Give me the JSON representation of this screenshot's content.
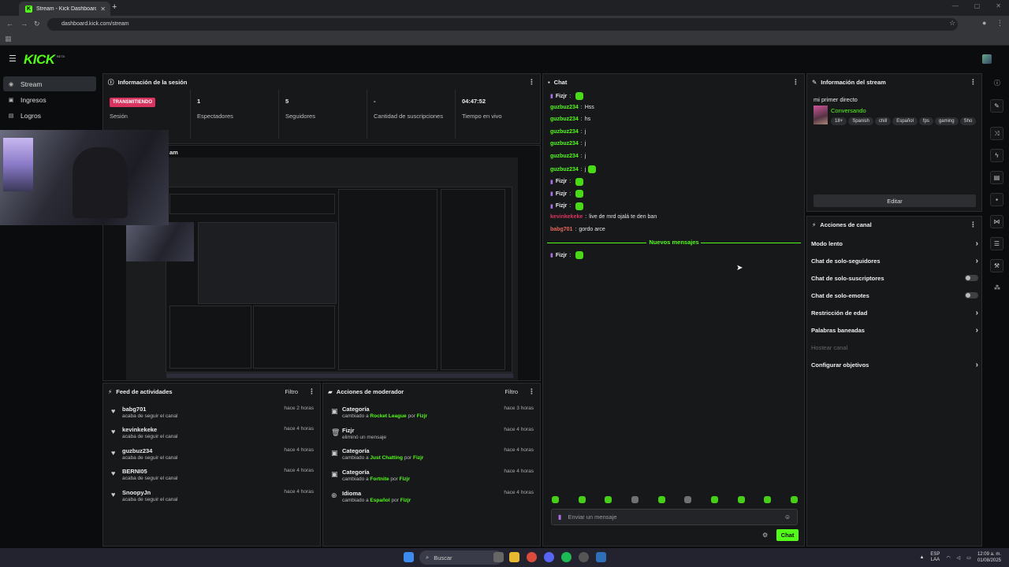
{
  "browser": {
    "tab_title": "Stream - Kick Dashboard",
    "url": "dashboard.kick.com/stream"
  },
  "header": {
    "logo": "KICK",
    "logo_badge": "BETA"
  },
  "sidebar": {
    "items": [
      {
        "label": "Stream",
        "icon": "video-icon"
      },
      {
        "label": "Ingresos",
        "icon": "money-icon"
      },
      {
        "label": "Logros",
        "icon": "trophy-icon"
      }
    ]
  },
  "session": {
    "title": "Información de la sesión",
    "status_badge": "TRANSMITIENDO",
    "stats": [
      {
        "value": "",
        "label": "Sesión"
      },
      {
        "value": "1",
        "label": "Espectadores"
      },
      {
        "value": "5",
        "label": "Seguidores"
      },
      {
        "value": "-",
        "label": "Cantidad de suscripciones"
      },
      {
        "value": "04:47:52",
        "label": "Tiempo en vivo"
      }
    ]
  },
  "preview": {
    "title": "am"
  },
  "activity": {
    "title": "Feed de actividades",
    "filter_label": "Filtro",
    "items": [
      {
        "name": "babg701",
        "desc": "acaba de seguir el canal",
        "time": "hace 2 horas"
      },
      {
        "name": "kevinkekeke",
        "desc": "acaba de seguir el canal",
        "time": "hace 4 horas"
      },
      {
        "name": "guzbuz234",
        "desc": "acaba de seguir el canal",
        "time": "hace 4 horas"
      },
      {
        "name": "BERNI05",
        "desc": "acaba de seguir el canal",
        "time": "hace 4 horas"
      },
      {
        "name": "SnoopyJn",
        "desc": "acaba de seguir el canal",
        "time": "hace 4 horas"
      }
    ]
  },
  "moderator": {
    "title": "Acciones de moderador",
    "filter_label": "Filtro",
    "items": [
      {
        "icon": "category-icon",
        "name": "Categoría",
        "pre": "cambiado a ",
        "target": "Rocket League",
        "mid": " por ",
        "by": "Fizjr",
        "time": "hace 3 horas"
      },
      {
        "icon": "trash-icon",
        "name": "Fizjr",
        "pre": "eliminó un mensaje",
        "target": "",
        "mid": "",
        "by": "",
        "time": "hace 4 horas"
      },
      {
        "icon": "category-icon",
        "name": "Categoría",
        "pre": "cambiado a ",
        "target": "Just Chatting",
        "mid": " por ",
        "by": "Fizjr",
        "time": "hace 4 horas"
      },
      {
        "icon": "category-icon",
        "name": "Categoría",
        "pre": "cambiado a ",
        "target": "Fortnite",
        "mid": " por ",
        "by": "Fizjr",
        "time": "hace 4 horas"
      },
      {
        "icon": "globe-icon",
        "name": "Idioma",
        "pre": "cambiado a ",
        "target": "Español",
        "mid": " por ",
        "by": "Fizjr",
        "time": "hace 4 horas"
      }
    ]
  },
  "chat": {
    "title": "Chat",
    "messages": [
      {
        "user": "Fizjr",
        "color": "#e8e8e8",
        "mic": true,
        "text": "",
        "emote": true
      },
      {
        "user": "guzbuz234",
        "color": "#53fc18",
        "mic": false,
        "text": "Hss",
        "emote": false
      },
      {
        "user": "guzbuz234",
        "color": "#53fc18",
        "mic": false,
        "text": "hs",
        "emote": false
      },
      {
        "user": "guzbuz234",
        "color": "#53fc18",
        "mic": false,
        "text": "j",
        "emote": false
      },
      {
        "user": "guzbuz234",
        "color": "#53fc18",
        "mic": false,
        "text": "j",
        "emote": false
      },
      {
        "user": "guzbuz234",
        "color": "#53fc18",
        "mic": false,
        "text": "j",
        "emote": false
      },
      {
        "user": "guzbuz234",
        "color": "#53fc18",
        "mic": false,
        "text": "j",
        "emote": true
      },
      {
        "user": "Fizjr",
        "color": "#e8e8e8",
        "mic": true,
        "text": "",
        "emote": true
      },
      {
        "user": "Fizjr",
        "color": "#e8e8e8",
        "mic": true,
        "text": "",
        "emote": true
      },
      {
        "user": "Fizjr",
        "color": "#e8e8e8",
        "mic": true,
        "text": "",
        "emote": true
      },
      {
        "user": "kevinkekeke",
        "color": "#d8345f",
        "mic": false,
        "text": "live de mrd ojalá te den ban",
        "emote": false
      },
      {
        "user": "babg701",
        "color": "#e86a5a",
        "mic": false,
        "text": "gordo arce",
        "emote": false
      }
    ],
    "new_messages_label": "Nuevos mensajes",
    "after_messages": [
      {
        "user": "Fizjr",
        "color": "#e8e8e8",
        "mic": true,
        "text": "",
        "emote": true
      }
    ],
    "input_placeholder": "Enviar un mensaje",
    "send_label": "Chat",
    "accent": "#53fc18"
  },
  "stream_info": {
    "title": "Información del stream",
    "stream_title": "mi primer directo",
    "category": "Conversando",
    "tags": [
      "18+",
      "Spanish",
      "chill",
      "Español",
      "fps",
      "gaming",
      "Sho"
    ],
    "edit_label": "Editar"
  },
  "channel_actions": {
    "title": "Acciones de canal",
    "items": [
      {
        "label": "Modo lento",
        "kind": "chevron"
      },
      {
        "label": "Chat de solo-seguidores",
        "kind": "chevron"
      },
      {
        "label": "Chat de solo-suscriptores",
        "kind": "toggle"
      },
      {
        "label": "Chat de solo-emotes",
        "kind": "toggle"
      },
      {
        "label": "Restricción de edad",
        "kind": "chevron"
      },
      {
        "label": "Palabras baneadas",
        "kind": "chevron"
      },
      {
        "label": "Hostear canal",
        "kind": "disabled"
      },
      {
        "label": "Configurar objetivos",
        "kind": "chevron"
      }
    ]
  },
  "taskbar": {
    "search_label": "Buscar",
    "lang": "ESP",
    "lang_sub": "LAA",
    "time": "12:09 a. m.",
    "date": "01/08/2025"
  }
}
